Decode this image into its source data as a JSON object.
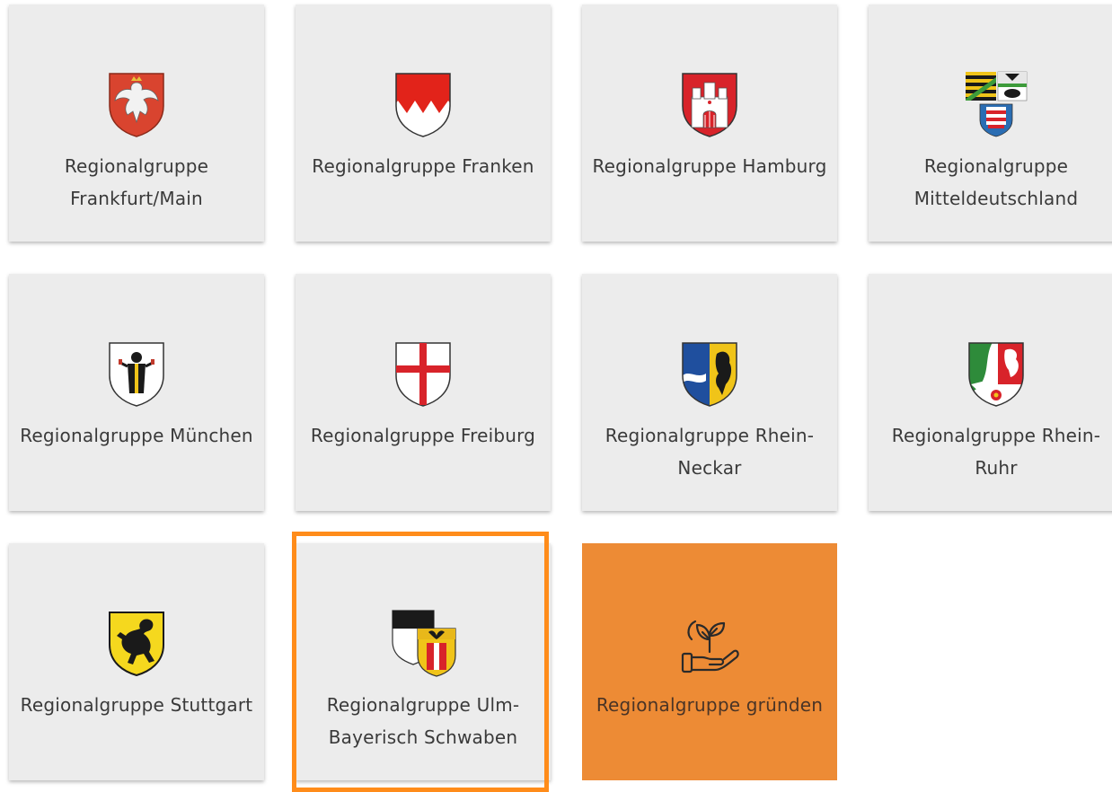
{
  "groups": [
    {
      "label": "Regionalgruppe Frankfurt/Main",
      "crest": "frankfurt-crest-icon"
    },
    {
      "label": "Regionalgruppe Franken",
      "crest": "franken-crest-icon"
    },
    {
      "label": "Regionalgruppe Hamburg",
      "crest": "hamburg-crest-icon"
    },
    {
      "label": "Regionalgruppe Mitteldeutschland",
      "crest": "mitteldeutschland-crest-icon"
    },
    {
      "label": "Regionalgruppe München",
      "crest": "muenchen-crest-icon"
    },
    {
      "label": "Regionalgruppe Freiburg",
      "crest": "freiburg-crest-icon"
    },
    {
      "label": "Regionalgruppe Rhein-Neckar",
      "crest": "rhein-neckar-crest-icon"
    },
    {
      "label": "Regionalgruppe Rhein-Ruhr",
      "crest": "rhein-ruhr-crest-icon"
    },
    {
      "label": "Regionalgruppe Stuttgart",
      "crest": "stuttgart-crest-icon"
    },
    {
      "label": "Regionalgruppe Ulm-Bayerisch Schwaben",
      "crest": "ulm-schwaben-crest-icon"
    }
  ],
  "cta": {
    "label": "Regionalgruppe gründen",
    "icon": "hand-plant-icon",
    "color": "#ed8b35"
  },
  "colors": {
    "card_bg": "#ececec",
    "highlight": "#ff8c1a",
    "text": "#3a3a3a"
  }
}
